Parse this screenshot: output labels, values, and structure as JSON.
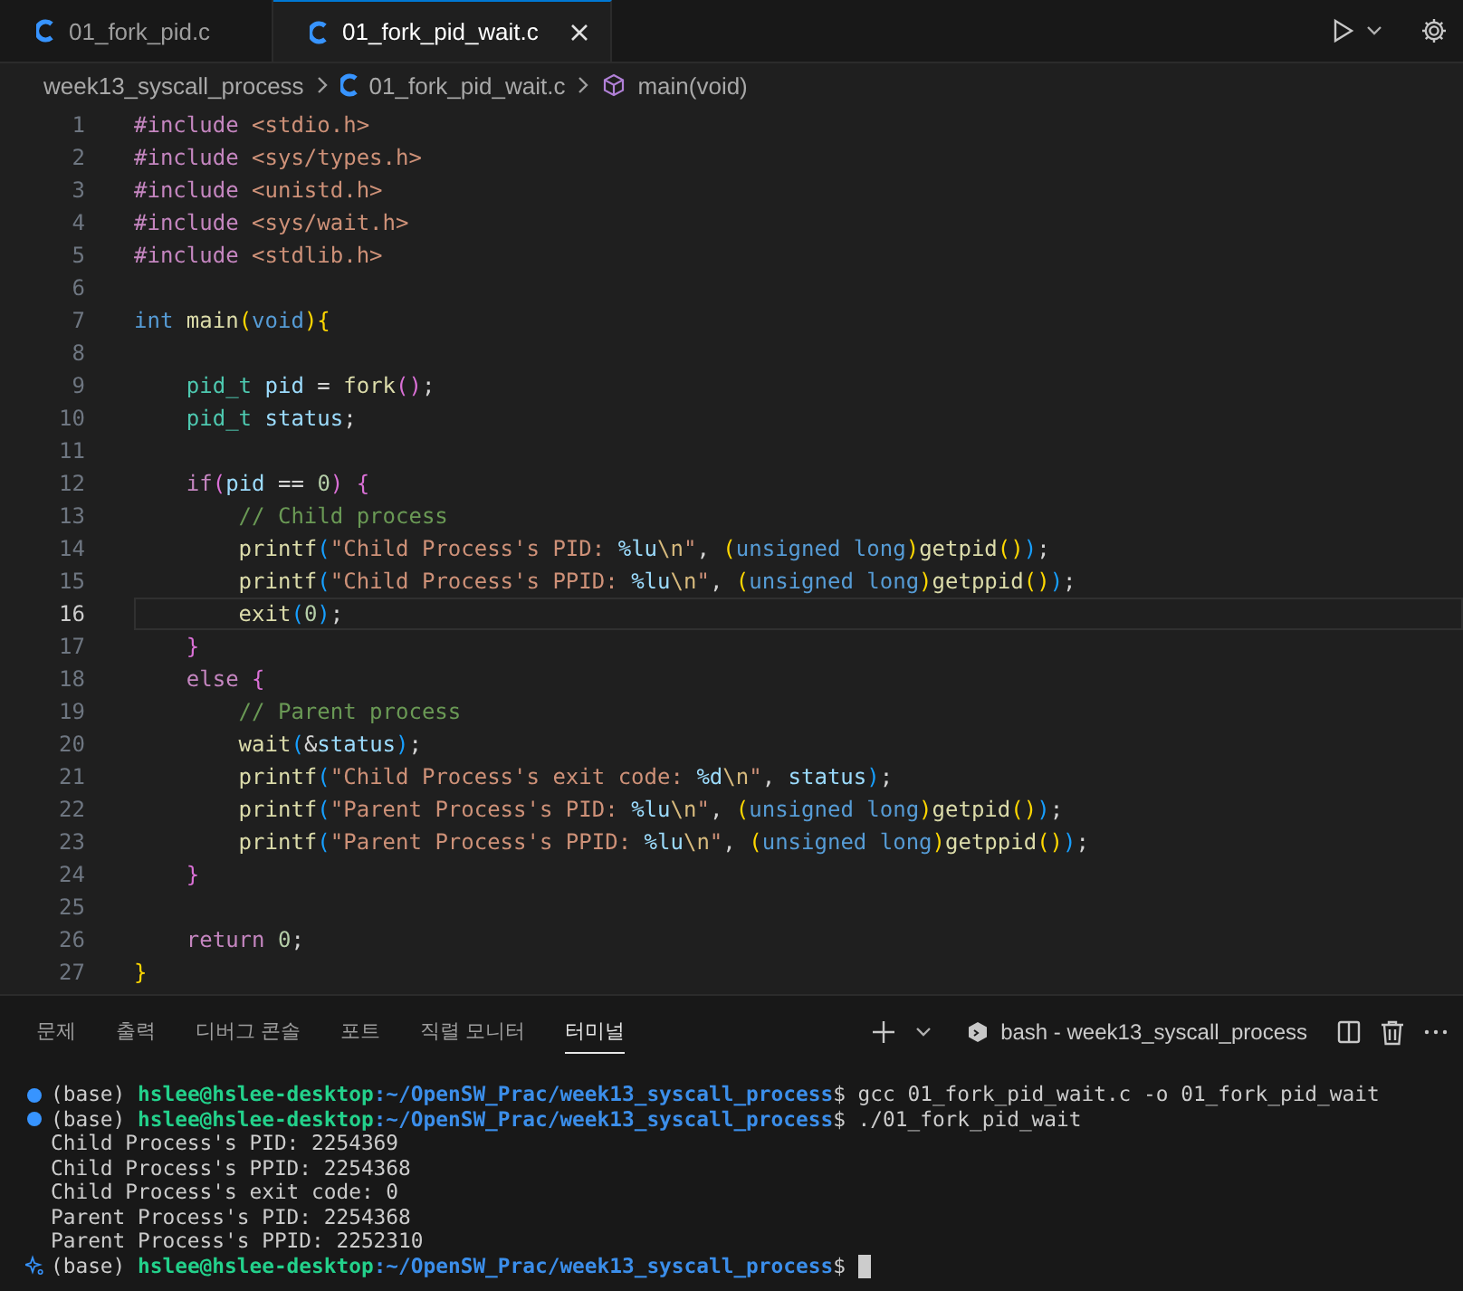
{
  "tabs": [
    {
      "label": "01_fork_pid.c",
      "selected": false
    },
    {
      "label": "01_fork_pid_wait.c",
      "selected": true
    }
  ],
  "breadcrumb": {
    "folder": "week13_syscall_process",
    "file": "01_fork_pid_wait.c",
    "symbol": "main(void)"
  },
  "editor": {
    "lines": [
      {
        "number": "1",
        "current": false,
        "tokens": [
          {
            "kind": "keyword",
            "text": "#include "
          },
          {
            "kind": "string",
            "text": "<stdio.h>"
          }
        ]
      },
      {
        "number": "2",
        "current": false,
        "tokens": [
          {
            "kind": "keyword",
            "text": "#include "
          },
          {
            "kind": "string",
            "text": "<sys/types.h>"
          }
        ]
      },
      {
        "number": "3",
        "current": false,
        "tokens": [
          {
            "kind": "keyword",
            "text": "#include "
          },
          {
            "kind": "string",
            "text": "<unistd.h>"
          }
        ]
      },
      {
        "number": "4",
        "current": false,
        "tokens": [
          {
            "kind": "keyword",
            "text": "#include "
          },
          {
            "kind": "string",
            "text": "<sys/wait.h>"
          }
        ]
      },
      {
        "number": "5",
        "current": false,
        "tokens": [
          {
            "kind": "keyword",
            "text": "#include "
          },
          {
            "kind": "string",
            "text": "<stdlib.h>"
          }
        ]
      },
      {
        "number": "6",
        "current": false
      },
      {
        "number": "7",
        "current": false,
        "tokens": [
          {
            "kind": "type",
            "text": "int "
          },
          {
            "kind": "function",
            "text": "main"
          },
          {
            "kind": "bracket1",
            "text": "("
          },
          {
            "kind": "type",
            "text": "void"
          },
          {
            "kind": "bracket1",
            "text": "){"
          }
        ]
      },
      {
        "number": "8",
        "current": false
      },
      {
        "number": "9",
        "current": false,
        "tokens": [
          {
            "kind": "typename",
            "text": "    pid_t "
          },
          {
            "kind": "variable",
            "text": "pid"
          },
          {
            "kind": "plain",
            "text": " = "
          },
          {
            "kind": "function",
            "text": "fork"
          },
          {
            "kind": "bracket2",
            "text": "()"
          },
          {
            "kind": "plain",
            "text": ";"
          }
        ]
      },
      {
        "number": "10",
        "current": false,
        "tokens": [
          {
            "kind": "typename",
            "text": "    pid_t "
          },
          {
            "kind": "variable",
            "text": "status"
          },
          {
            "kind": "plain",
            "text": ";"
          }
        ]
      },
      {
        "number": "11",
        "current": false
      },
      {
        "number": "12",
        "current": false,
        "tokens": [
          {
            "kind": "keyword",
            "text": "    if"
          },
          {
            "kind": "bracket2",
            "text": "("
          },
          {
            "kind": "variable",
            "text": "pid"
          },
          {
            "kind": "plain",
            "text": " == "
          },
          {
            "kind": "number",
            "text": "0"
          },
          {
            "kind": "bracket2",
            "text": ") {"
          }
        ]
      },
      {
        "number": "13",
        "current": false,
        "tokens": [
          {
            "kind": "comment",
            "text": "        // Child process"
          }
        ]
      },
      {
        "number": "14",
        "current": false,
        "tokens": [
          {
            "kind": "function",
            "text": "        printf"
          },
          {
            "kind": "bracket3",
            "text": "("
          },
          {
            "kind": "string",
            "text": "\"Child Process's PID: "
          },
          {
            "kind": "variable",
            "text": "%lu"
          },
          {
            "kind": "escape",
            "text": "\\n"
          },
          {
            "kind": "string",
            "text": "\""
          },
          {
            "kind": "plain",
            "text": ", "
          },
          {
            "kind": "bracket1",
            "text": "("
          },
          {
            "kind": "type",
            "text": "unsigned long"
          },
          {
            "kind": "bracket1",
            "text": ")"
          },
          {
            "kind": "function",
            "text": "getpid"
          },
          {
            "kind": "bracket1",
            "text": "()"
          },
          {
            "kind": "bracket3",
            "text": ")"
          },
          {
            "kind": "plain",
            "text": ";"
          }
        ]
      },
      {
        "number": "15",
        "current": false,
        "tokens": [
          {
            "kind": "function",
            "text": "        printf"
          },
          {
            "kind": "bracket3",
            "text": "("
          },
          {
            "kind": "string",
            "text": "\"Child Process's PPID: "
          },
          {
            "kind": "variable",
            "text": "%lu"
          },
          {
            "kind": "escape",
            "text": "\\n"
          },
          {
            "kind": "string",
            "text": "\""
          },
          {
            "kind": "plain",
            "text": ", "
          },
          {
            "kind": "bracket1",
            "text": "("
          },
          {
            "kind": "type",
            "text": "unsigned long"
          },
          {
            "kind": "bracket1",
            "text": ")"
          },
          {
            "kind": "function",
            "text": "getppid"
          },
          {
            "kind": "bracket1",
            "text": "()"
          },
          {
            "kind": "bracket3",
            "text": ")"
          },
          {
            "kind": "plain",
            "text": ";"
          }
        ]
      },
      {
        "number": "16",
        "current": true,
        "tokens": [
          {
            "kind": "function",
            "text": "        exit"
          },
          {
            "kind": "bracket3",
            "text": "("
          },
          {
            "kind": "number",
            "text": "0"
          },
          {
            "kind": "bracket3",
            "text": ")"
          },
          {
            "kind": "plain",
            "text": ";"
          }
        ]
      },
      {
        "number": "17",
        "current": false,
        "tokens": [
          {
            "kind": "bracket2",
            "text": "    }"
          }
        ]
      },
      {
        "number": "18",
        "current": false,
        "tokens": [
          {
            "kind": "keyword",
            "text": "    else "
          },
          {
            "kind": "bracket2",
            "text": "{"
          }
        ]
      },
      {
        "number": "19",
        "current": false,
        "tokens": [
          {
            "kind": "comment",
            "text": "        // Parent process"
          }
        ]
      },
      {
        "number": "20",
        "current": false,
        "tokens": [
          {
            "kind": "function",
            "text": "        wait"
          },
          {
            "kind": "bracket3",
            "text": "("
          },
          {
            "kind": "plain",
            "text": "&"
          },
          {
            "kind": "variable",
            "text": "status"
          },
          {
            "kind": "bracket3",
            "text": ")"
          },
          {
            "kind": "plain",
            "text": ";"
          }
        ]
      },
      {
        "number": "21",
        "current": false,
        "tokens": [
          {
            "kind": "function",
            "text": "        printf"
          },
          {
            "kind": "bracket3",
            "text": "("
          },
          {
            "kind": "string",
            "text": "\"Child Process's exit code: "
          },
          {
            "kind": "variable",
            "text": "%d"
          },
          {
            "kind": "escape",
            "text": "\\n"
          },
          {
            "kind": "string",
            "text": "\""
          },
          {
            "kind": "plain",
            "text": ", "
          },
          {
            "kind": "variable",
            "text": "status"
          },
          {
            "kind": "bracket3",
            "text": ")"
          },
          {
            "kind": "plain",
            "text": ";"
          }
        ]
      },
      {
        "number": "22",
        "current": false,
        "tokens": [
          {
            "kind": "function",
            "text": "        printf"
          },
          {
            "kind": "bracket3",
            "text": "("
          },
          {
            "kind": "string",
            "text": "\"Parent Process's PID: "
          },
          {
            "kind": "variable",
            "text": "%lu"
          },
          {
            "kind": "escape",
            "text": "\\n"
          },
          {
            "kind": "string",
            "text": "\""
          },
          {
            "kind": "plain",
            "text": ", "
          },
          {
            "kind": "bracket1",
            "text": "("
          },
          {
            "kind": "type",
            "text": "unsigned long"
          },
          {
            "kind": "bracket1",
            "text": ")"
          },
          {
            "kind": "function",
            "text": "getpid"
          },
          {
            "kind": "bracket1",
            "text": "()"
          },
          {
            "kind": "bracket3",
            "text": ")"
          },
          {
            "kind": "plain",
            "text": ";"
          }
        ]
      },
      {
        "number": "23",
        "current": false,
        "tokens": [
          {
            "kind": "function",
            "text": "        printf"
          },
          {
            "kind": "bracket3",
            "text": "("
          },
          {
            "kind": "string",
            "text": "\"Parent Process's PPID: "
          },
          {
            "kind": "variable",
            "text": "%lu"
          },
          {
            "kind": "escape",
            "text": "\\n"
          },
          {
            "kind": "string",
            "text": "\""
          },
          {
            "kind": "plain",
            "text": ", "
          },
          {
            "kind": "bracket1",
            "text": "("
          },
          {
            "kind": "type",
            "text": "unsigned long"
          },
          {
            "kind": "bracket1",
            "text": ")"
          },
          {
            "kind": "function",
            "text": "getppid"
          },
          {
            "kind": "bracket1",
            "text": "()"
          },
          {
            "kind": "bracket3",
            "text": ")"
          },
          {
            "kind": "plain",
            "text": ";"
          }
        ]
      },
      {
        "number": "24",
        "current": false,
        "tokens": [
          {
            "kind": "bracket2",
            "text": "    }"
          }
        ]
      },
      {
        "number": "25",
        "current": false
      },
      {
        "number": "26",
        "current": false,
        "tokens": [
          {
            "kind": "keyword",
            "text": "    return "
          },
          {
            "kind": "number",
            "text": "0"
          },
          {
            "kind": "plain",
            "text": ";"
          }
        ]
      },
      {
        "number": "27",
        "current": false,
        "tokens": [
          {
            "kind": "bracket1",
            "text": "}"
          }
        ]
      }
    ]
  },
  "panel": {
    "tabs": [
      {
        "label": "문제",
        "selected": false
      },
      {
        "label": "출력",
        "selected": false
      },
      {
        "label": "디버그 콘솔",
        "selected": false
      },
      {
        "label": "포트",
        "selected": false
      },
      {
        "label": "직렬 모니터",
        "selected": false
      },
      {
        "label": "터미널",
        "selected": true
      }
    ],
    "shell_label": "bash - week13_syscall_process",
    "terminal": [
      {
        "kind": "prompt",
        "marker": {
          "kind": "dot"
        },
        "env": "(base)",
        "user": "hslee@hslee-desktop",
        "path": ":~/OpenSW_Prac/week13_syscall_process",
        "sign": "$",
        "command": "gcc 01_fork_pid_wait.c -o 01_fork_pid_wait",
        "cursor": false
      },
      {
        "kind": "prompt",
        "marker": {
          "kind": "dot"
        },
        "env": "(base)",
        "user": "hslee@hslee-desktop",
        "path": ":~/OpenSW_Prac/week13_syscall_process",
        "sign": "$",
        "command": "./01_fork_pid_wait",
        "cursor": false
      },
      {
        "kind": "output",
        "text": "Child Process's PID: 2254369"
      },
      {
        "kind": "output",
        "text": "Child Process's PPID: 2254368"
      },
      {
        "kind": "output",
        "text": "Child Process's exit code: 0"
      },
      {
        "kind": "output",
        "text": "Parent Process's PID: 2254368"
      },
      {
        "kind": "output",
        "text": "Parent Process's PPID: 2252310"
      },
      {
        "kind": "prompt",
        "marker": {
          "kind": "sparkle"
        },
        "env": "(base)",
        "user": "hslee@hslee-desktop",
        "path": ":~/OpenSW_Prac/week13_syscall_process",
        "sign": "$",
        "cursor": true
      }
    ]
  }
}
